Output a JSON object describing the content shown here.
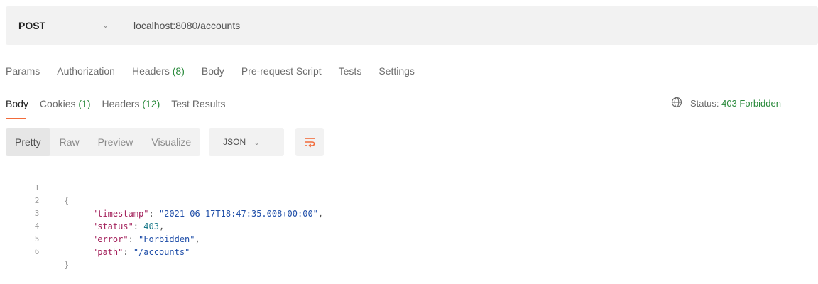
{
  "request": {
    "method": "POST",
    "url": "localhost:8080/accounts"
  },
  "request_tabs": [
    {
      "label": "Params",
      "count": ""
    },
    {
      "label": "Authorization",
      "count": ""
    },
    {
      "label": "Headers",
      "count": "(8)"
    },
    {
      "label": "Body",
      "count": ""
    },
    {
      "label": "Pre-request Script",
      "count": ""
    },
    {
      "label": "Tests",
      "count": ""
    },
    {
      "label": "Settings",
      "count": ""
    }
  ],
  "response_tabs": [
    {
      "label": "Body",
      "count": ""
    },
    {
      "label": "Cookies",
      "count": "(1)"
    },
    {
      "label": "Headers",
      "count": "(12)"
    },
    {
      "label": "Test Results",
      "count": ""
    }
  ],
  "status": {
    "label": "Status:",
    "value": "403 Forbidden"
  },
  "view_modes": [
    "Pretty",
    "Raw",
    "Preview",
    "Visualize"
  ],
  "format": "JSON",
  "body_lines": {
    "numbers": [
      "1",
      "2",
      "3",
      "4",
      "5",
      "6"
    ],
    "open_brace": "{",
    "close_brace": "}",
    "timestamp_key": "\"timestamp\"",
    "timestamp_value": "\"2021-06-17T18:47:35.008+00:00\"",
    "status_key": "\"status\"",
    "status_value": "403",
    "error_key": "\"error\"",
    "error_value": "\"Forbidden\"",
    "path_key": "\"path\"",
    "path_value_open": "\"",
    "path_value_link": "/accounts",
    "path_value_close": "\""
  },
  "colors": {
    "accent": "#f26b3a",
    "count_green": "#2a8a3c",
    "json_key": "#a4225c",
    "json_string": "#1f4ea8"
  }
}
